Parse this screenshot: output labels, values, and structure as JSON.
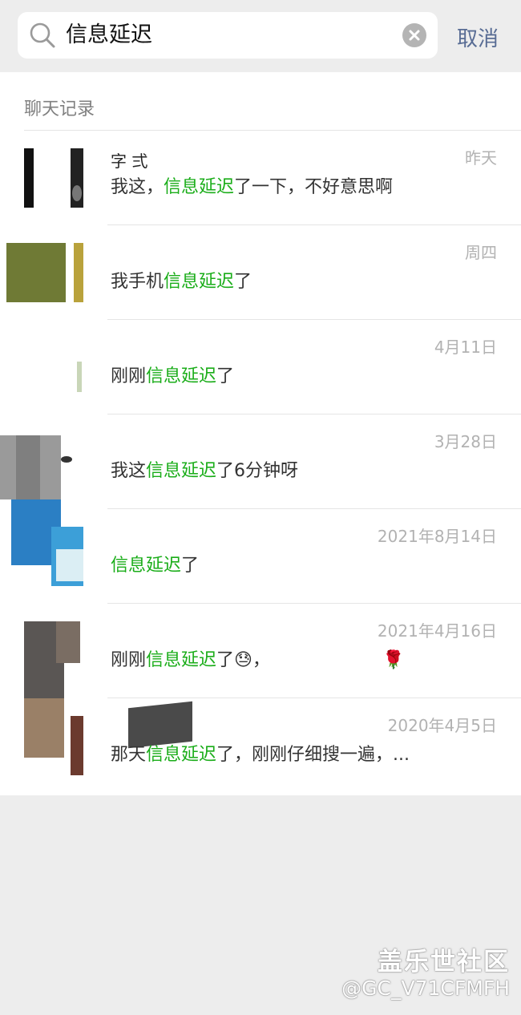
{
  "search": {
    "query": "信息延迟",
    "cancel_label": "取消"
  },
  "section": {
    "title": "聊天记录"
  },
  "results": [
    {
      "name": "字    弍",
      "date": "昨天",
      "pre": "我这，",
      "hl": "信息延迟",
      "post": "了一下，不好意思啊"
    },
    {
      "name": "",
      "date": "周四",
      "pre": "我手机",
      "hl": "信息延迟",
      "post": "了"
    },
    {
      "name": "",
      "date": "4月11日",
      "pre": "刚刚",
      "hl": "信息延迟",
      "post": "了"
    },
    {
      "name": "",
      "date": "3月28日",
      "pre": "我这",
      "hl": "信息延迟",
      "post": "了6分钟呀"
    },
    {
      "name": "",
      "date": "2021年8月14日",
      "pre": "",
      "hl": "信息延迟",
      "post": "了"
    },
    {
      "name": "",
      "date": "2021年4月16日",
      "pre": "刚刚",
      "hl": "信息延迟",
      "post": "了😓，"
    },
    {
      "name": "",
      "date": "2020年4月5日",
      "pre": "那天",
      "hl": "信息延迟",
      "post": "了，刚刚仔细搜一遍，..."
    }
  ],
  "icons": {
    "search": "search-icon",
    "clear": "clear-icon",
    "rose": "rose-icon"
  },
  "watermark": {
    "line1": "盖乐世社区",
    "line2": "@GC_V71CFMFH"
  },
  "colors": {
    "highlight": "#1aad19",
    "cancel": "#586c94",
    "background": "#ededed"
  }
}
